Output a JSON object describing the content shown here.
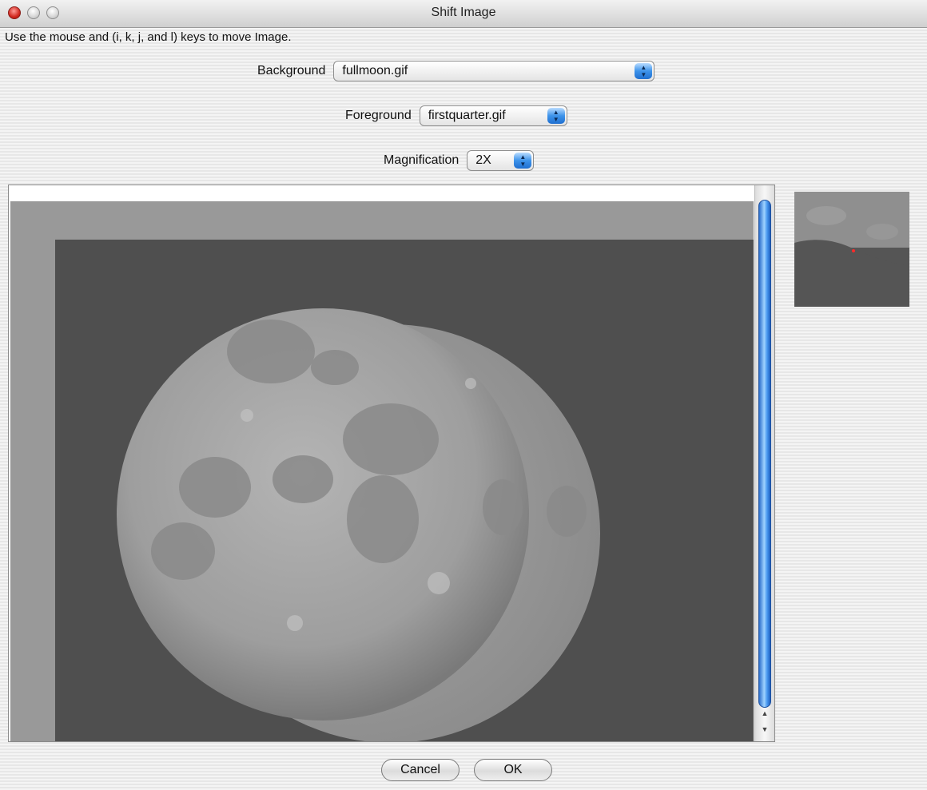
{
  "window": {
    "title": "Shift Image"
  },
  "instructions": "Use the mouse and (i, k, j, and l) keys to move Image.",
  "controls": {
    "background": {
      "label": "Background",
      "value": "fullmoon.gif"
    },
    "foreground": {
      "label": "Foreground",
      "value": "firstquarter.gif"
    },
    "magnification": {
      "label": "Magnification",
      "value": "2X"
    }
  },
  "buttons": {
    "cancel": "Cancel",
    "ok": "OK"
  },
  "scrollbar": {
    "up_glyph": "▲",
    "down_glyph": "▼"
  },
  "popup_arrow_glyphs": {
    "up": "▲",
    "down": "▼"
  },
  "colors": {
    "scroll_thumb": "#4a9af0",
    "popup_arrows": "#3d93ea",
    "outer_canvas": "#999999",
    "inner_canvas": "#4f4f4f",
    "preview_marker": "#ff2a2a"
  }
}
